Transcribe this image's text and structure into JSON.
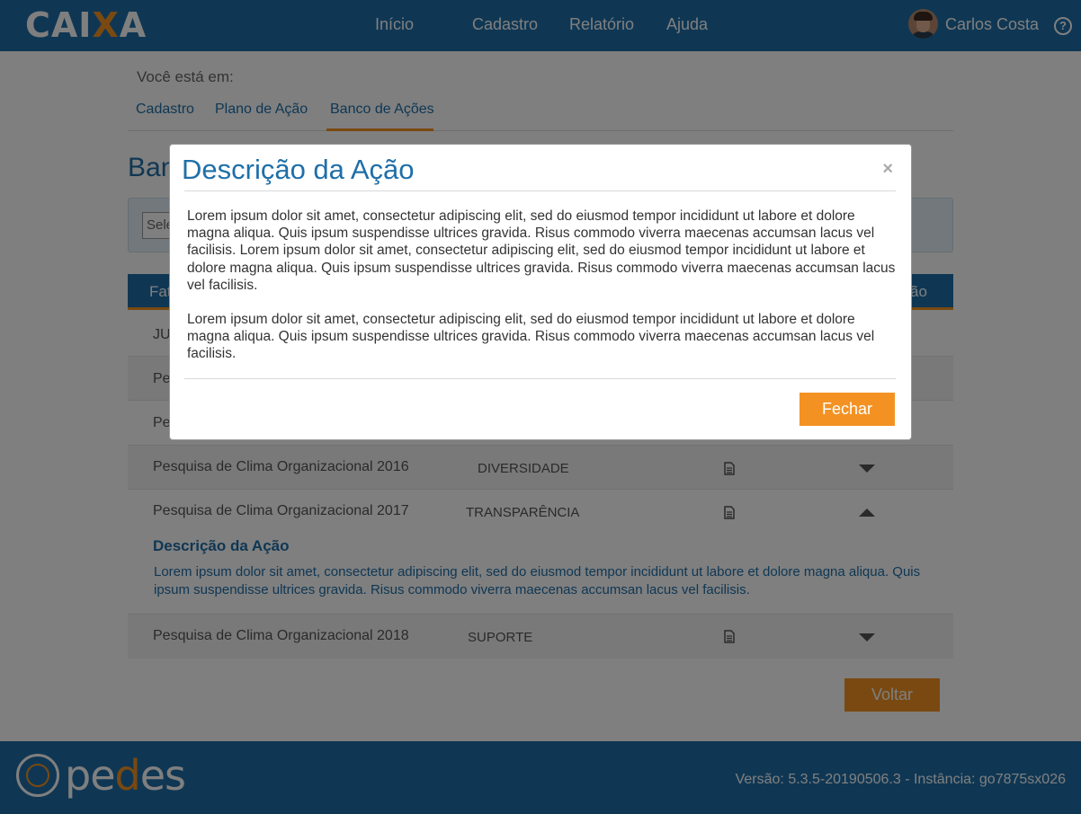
{
  "header": {
    "logo": {
      "pre": "CAI",
      "x": "X",
      "post": "A"
    },
    "nav": [
      "Início",
      "Cadastro",
      "Relatório",
      "Ajuda"
    ],
    "user_name": "Carlos Costa",
    "help": "?"
  },
  "breadcrumb": {
    "label": "Você está em:",
    "items": [
      "Cadastro",
      "Plano de Ação",
      "Banco de Ações"
    ],
    "active_index": 2
  },
  "page": {
    "title_partial": "Ban",
    "filter_select_partial": "Sele",
    "table_header_partial_left": "Fat",
    "table_header_partial_right": "ão"
  },
  "table": {
    "hidden_rows_partial": [
      "JUS",
      "Pes",
      "Pes"
    ],
    "rows": [
      {
        "name": "Pesquisa de Clima Organizacional 2016",
        "category": "DIVERSIDADE",
        "expanded": false
      },
      {
        "name": "Pesquisa de Clima Organizacional 2017",
        "category": "TRANSPARÊNCIA",
        "expanded": true
      },
      {
        "name": "Pesquisa de Clima Organizacional 2018",
        "category": "SUPORTE",
        "expanded": false
      }
    ],
    "expanded_detail": {
      "title": "Descrição da Ação",
      "text": "Lorem ipsum dolor sit amet, consectetur adipiscing elit, sed do eiusmod tempor incididunt ut labore et dolore magna aliqua. Quis ipsum suspendisse ultrices gravida. Risus commodo viverra maecenas accumsan lacus vel facilisis."
    }
  },
  "voltar_label": "Voltar",
  "modal": {
    "title": "Descrição da Ação",
    "close": "×",
    "paragraphs": [
      "Lorem ipsum dolor sit amet, consectetur adipiscing elit, sed do eiusmod tempor incididunt ut labore et dolore magna aliqua. Quis ipsum suspendisse ultrices gravida. Risus commodo viverra maecenas accumsan lacus vel facilisis. Lorem ipsum dolor sit amet, consectetur adipiscing elit, sed do eiusmod tempor incididunt ut labore et dolore magna aliqua. Quis ipsum suspendisse ultrices gravida. Risus commodo viverra maecenas accumsan lacus vel facilisis.",
      "Lorem ipsum dolor sit amet, consectetur adipiscing elit, sed do eiusmod tempor incididunt ut labore et dolore magna aliqua. Quis ipsum suspendisse ultrices gravida. Risus commodo viverra maecenas accumsan lacus vel facilisis."
    ],
    "button": "Fechar"
  },
  "footer": {
    "brand": {
      "pre": "pe",
      "d": "d",
      "post": "es"
    },
    "version": "Versão: 5.3.5-20190506.3 - Instância: go7875sx026"
  },
  "colors": {
    "primary": "#1f6fa8",
    "accent": "#f39223",
    "overlay": "rgba(0,0,0,0.5)"
  },
  "icons": [
    "help-icon",
    "document-icon",
    "chevron-down-icon",
    "chevron-up-icon",
    "close-icon",
    "pedes-logo-icon",
    "avatar"
  ]
}
